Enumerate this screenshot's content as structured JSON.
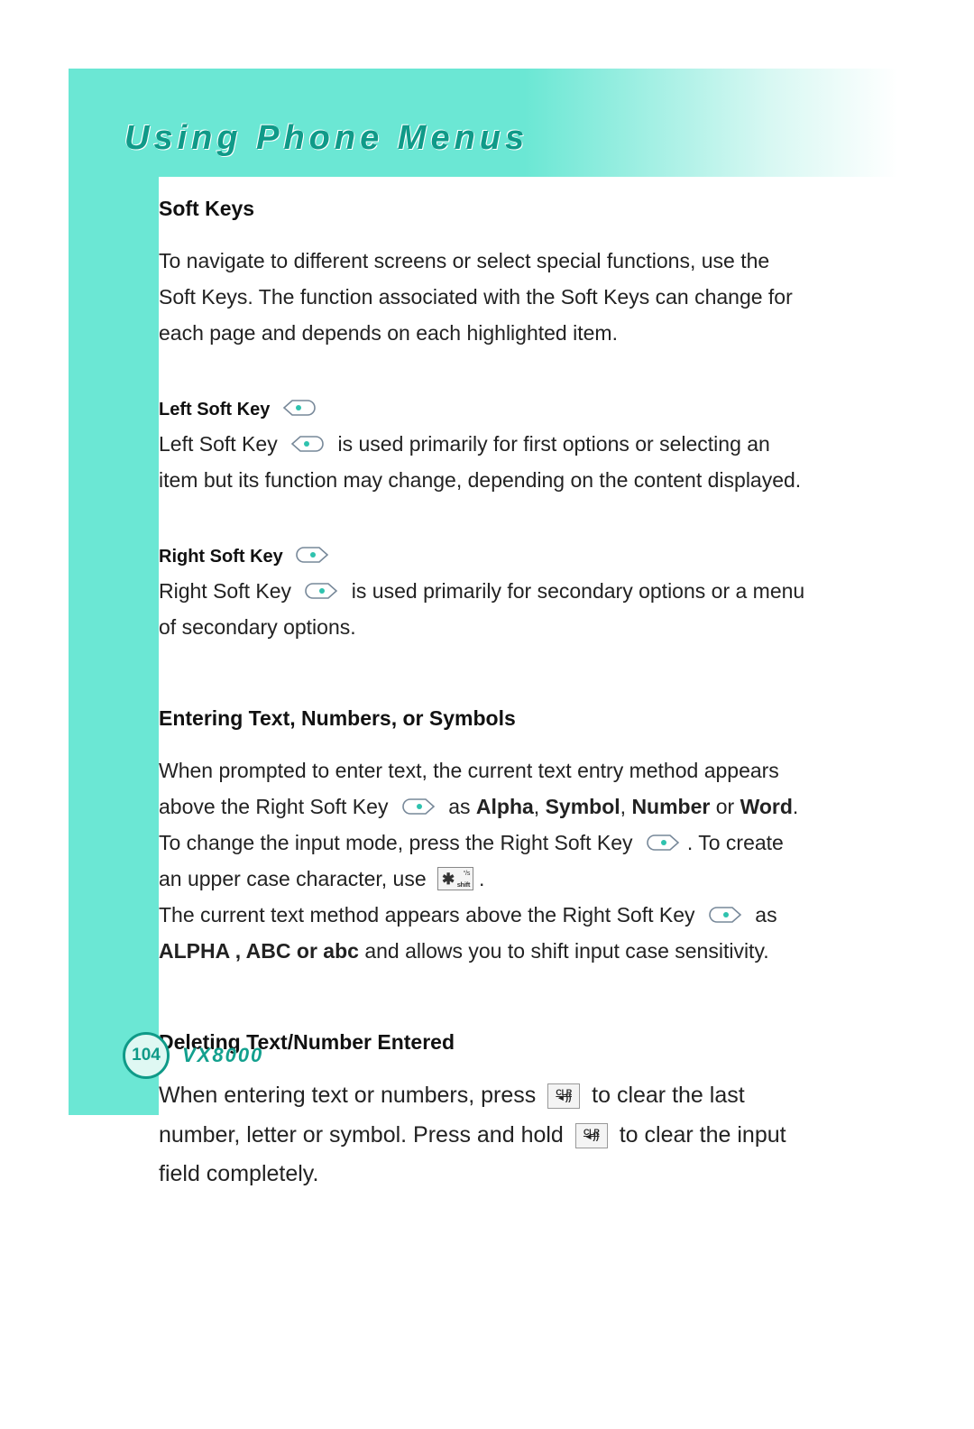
{
  "page_title": "Using Phone Menus",
  "page_number": "104",
  "model": "VX8000",
  "sections": {
    "soft_keys": {
      "heading": "Soft Keys",
      "intro": "To navigate to different screens or select special functions, use the Soft Keys. The function associated with the Soft Keys can change for each page and depends on each highlighted item.",
      "left": {
        "heading": "Left Soft Key",
        "pre": "Left Soft Key ",
        "post": " is used primarily for first options or selecting an item but its function may change, depending on the content displayed."
      },
      "right": {
        "heading": "Right Soft Key",
        "pre": "Right Soft Key ",
        "post": " is used primarily for secondary options or a menu of secondary options."
      }
    },
    "entering": {
      "heading": "Entering Text, Numbers, or Symbols",
      "p1_a": "When prompted to enter text, the current text entry method appears above the Right Soft Key ",
      "p1_b": " as ",
      "p1_modes_alpha": "Alpha",
      "p1_sep1": ", ",
      "p1_modes_symbol": "Symbol",
      "p1_sep2": ", ",
      "p1_modes_number": "Number",
      "p1_or": " or ",
      "p1_modes_word": "Word",
      "p1_end": ". To change the input mode, press the Right Soft Key ",
      "p1_end2": ". To create an upper case character, use ",
      "p1_end3": ".",
      "p2_a": "The current text method appears above the Right Soft Key ",
      "p2_b": " as ",
      "p2_modes": "ALPHA , ABC or abc",
      "p2_end": " and allows you to shift input case sensitivity."
    },
    "deleting": {
      "heading": "Deleting Text/Number Entered",
      "a": "When entering text or numbers, press ",
      "b": " to clear the last number, letter or symbol. Press and hold ",
      "c": " to clear the input field completely."
    }
  },
  "icons": {
    "left_soft_key": "left-soft-key-icon",
    "right_soft_key": "right-soft-key-icon",
    "star_key": "star-shift-key-icon",
    "clr_key": "clr-key-icon"
  },
  "key_labels": {
    "star": "✱",
    "star_sub_top": "°/s",
    "star_sub_bottom": "shift",
    "clr_top": "CLR",
    "clr_bottom": "◄))"
  }
}
